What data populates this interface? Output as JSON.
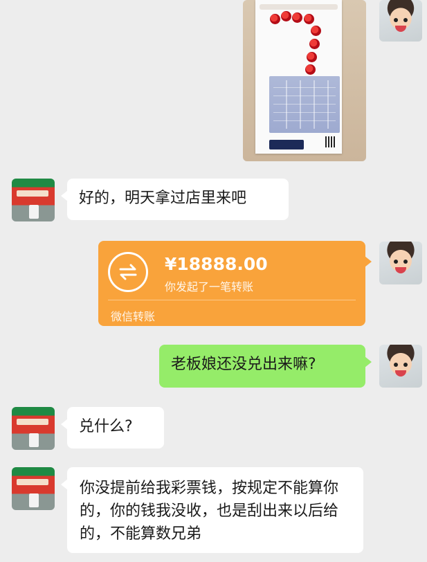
{
  "messages": [
    {
      "sender": "me",
      "type": "image",
      "content": "lottery-ticket-photo"
    },
    {
      "sender": "other",
      "type": "text",
      "text": "好的，明天拿过店里来吧"
    },
    {
      "sender": "me",
      "type": "transfer",
      "amount": "¥18888.00",
      "description": "你发起了一笔转账",
      "footer": "微信转账"
    },
    {
      "sender": "me",
      "type": "text",
      "text": "老板娘还没兑出来嘛?"
    },
    {
      "sender": "other",
      "type": "text",
      "text": "兑什么?"
    },
    {
      "sender": "other",
      "type": "text",
      "text": "你没提前给我彩票钱，按规定不能算你的，你的钱我没收，也是刮出来以后给的，不能算数兄弟"
    }
  ],
  "colors": {
    "chat_background": "#ededed",
    "my_bubble": "#95ec69",
    "other_bubble": "#ffffff",
    "transfer_card": "#f9a33b"
  }
}
